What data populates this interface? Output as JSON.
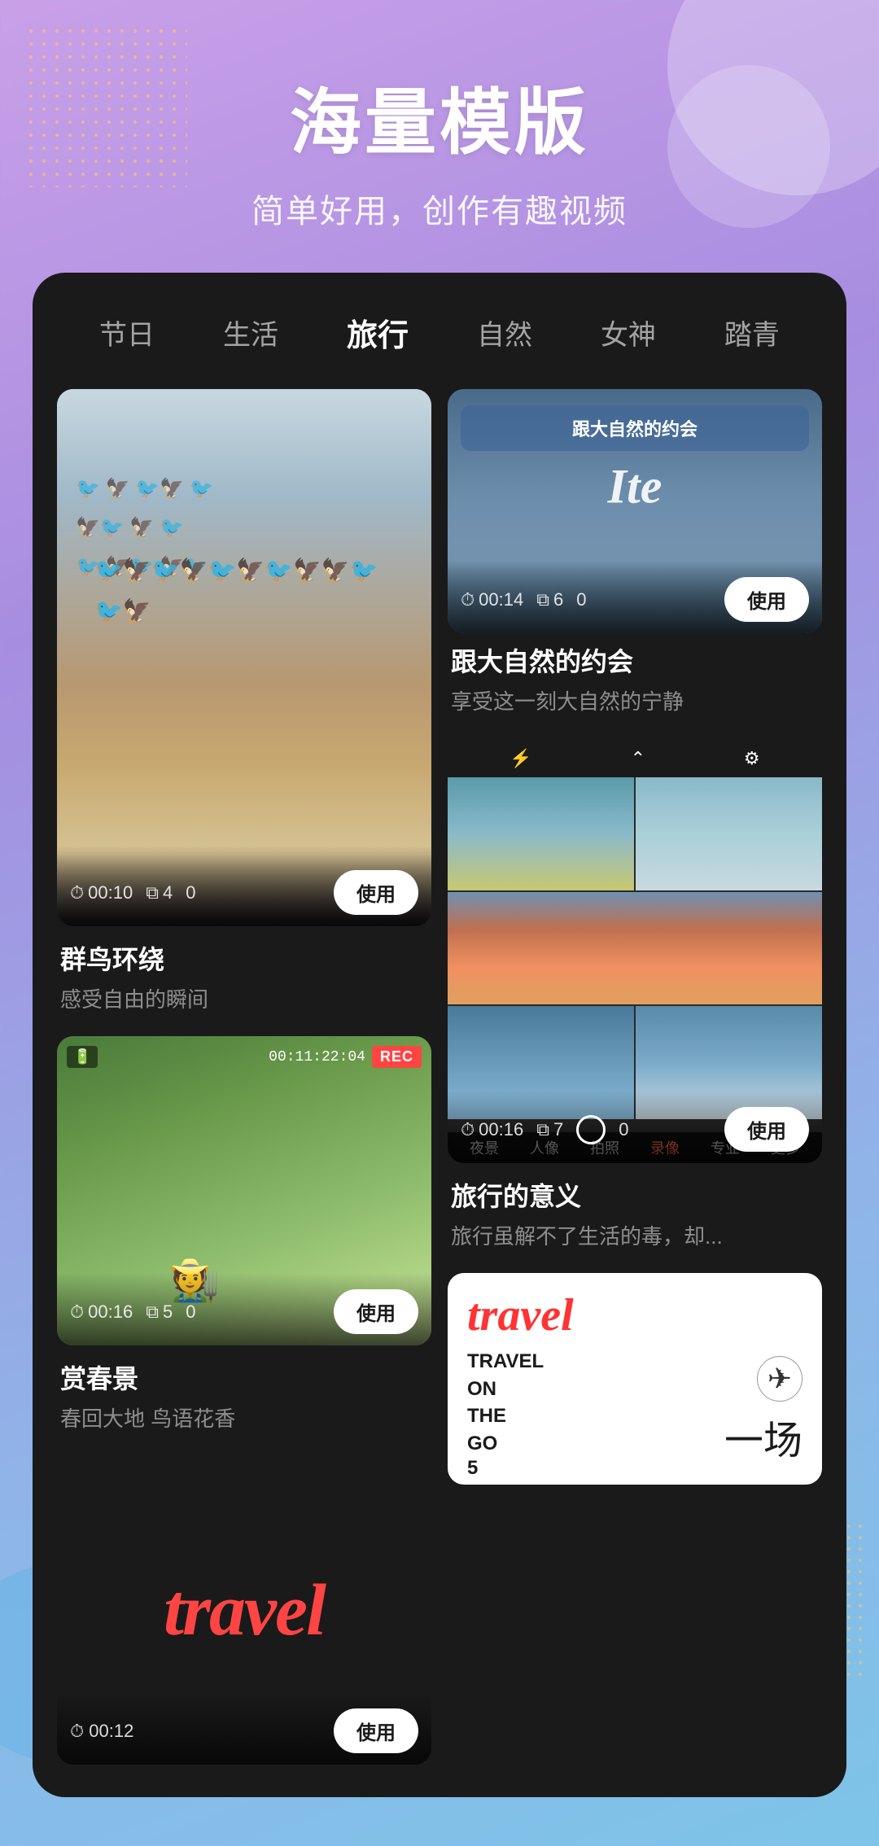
{
  "header": {
    "title": "海量模版",
    "subtitle": "简单好用，创作有趣视频"
  },
  "tabs": {
    "items": [
      {
        "label": "节日",
        "active": false
      },
      {
        "label": "生活",
        "active": false
      },
      {
        "label": "旅行",
        "active": true
      },
      {
        "label": "自然",
        "active": false
      },
      {
        "label": "女神",
        "active": false
      },
      {
        "label": "踏青",
        "active": false
      }
    ]
  },
  "cards": {
    "birds": {
      "title": "群鸟环绕",
      "desc": "感受自由的瞬间",
      "duration": "00:10",
      "clips": "4",
      "likes": "0",
      "use_btn": "使用"
    },
    "nature": {
      "title": "跟大自然的约会",
      "desc": "享受这一刻大自然的宁静",
      "duration": "00:14",
      "clips": "6",
      "likes": "0",
      "use_btn": "使用",
      "overlay_text": "跟大自然的约会"
    },
    "spring": {
      "title": "赏春景",
      "desc": "春回大地 鸟语花香",
      "duration": "00:16",
      "clips": "5",
      "likes": "0",
      "use_btn": "使用",
      "rec": "REC",
      "time_code": "00:11:22:04"
    },
    "travel_meaning": {
      "title": "旅行的意义",
      "desc": "旅行虽解不了生活的毒，却...",
      "duration": "00:16",
      "clips": "7",
      "likes": "0",
      "use_btn": "使用"
    },
    "travel_go": {
      "travel_text": "travel",
      "en_line1": "TRAVEL",
      "en_line2": "ON",
      "en_line3": "THE",
      "en_line4": "GO",
      "en_number": "5",
      "cn_text": "一场",
      "plane_icon": "✈"
    }
  },
  "filter_labels": [
    "夜景",
    "人像",
    "拍照",
    "录像",
    "专业",
    "更多"
  ],
  "icons": {
    "clock": "⏱",
    "layers": "⧉",
    "heart": "♡"
  }
}
